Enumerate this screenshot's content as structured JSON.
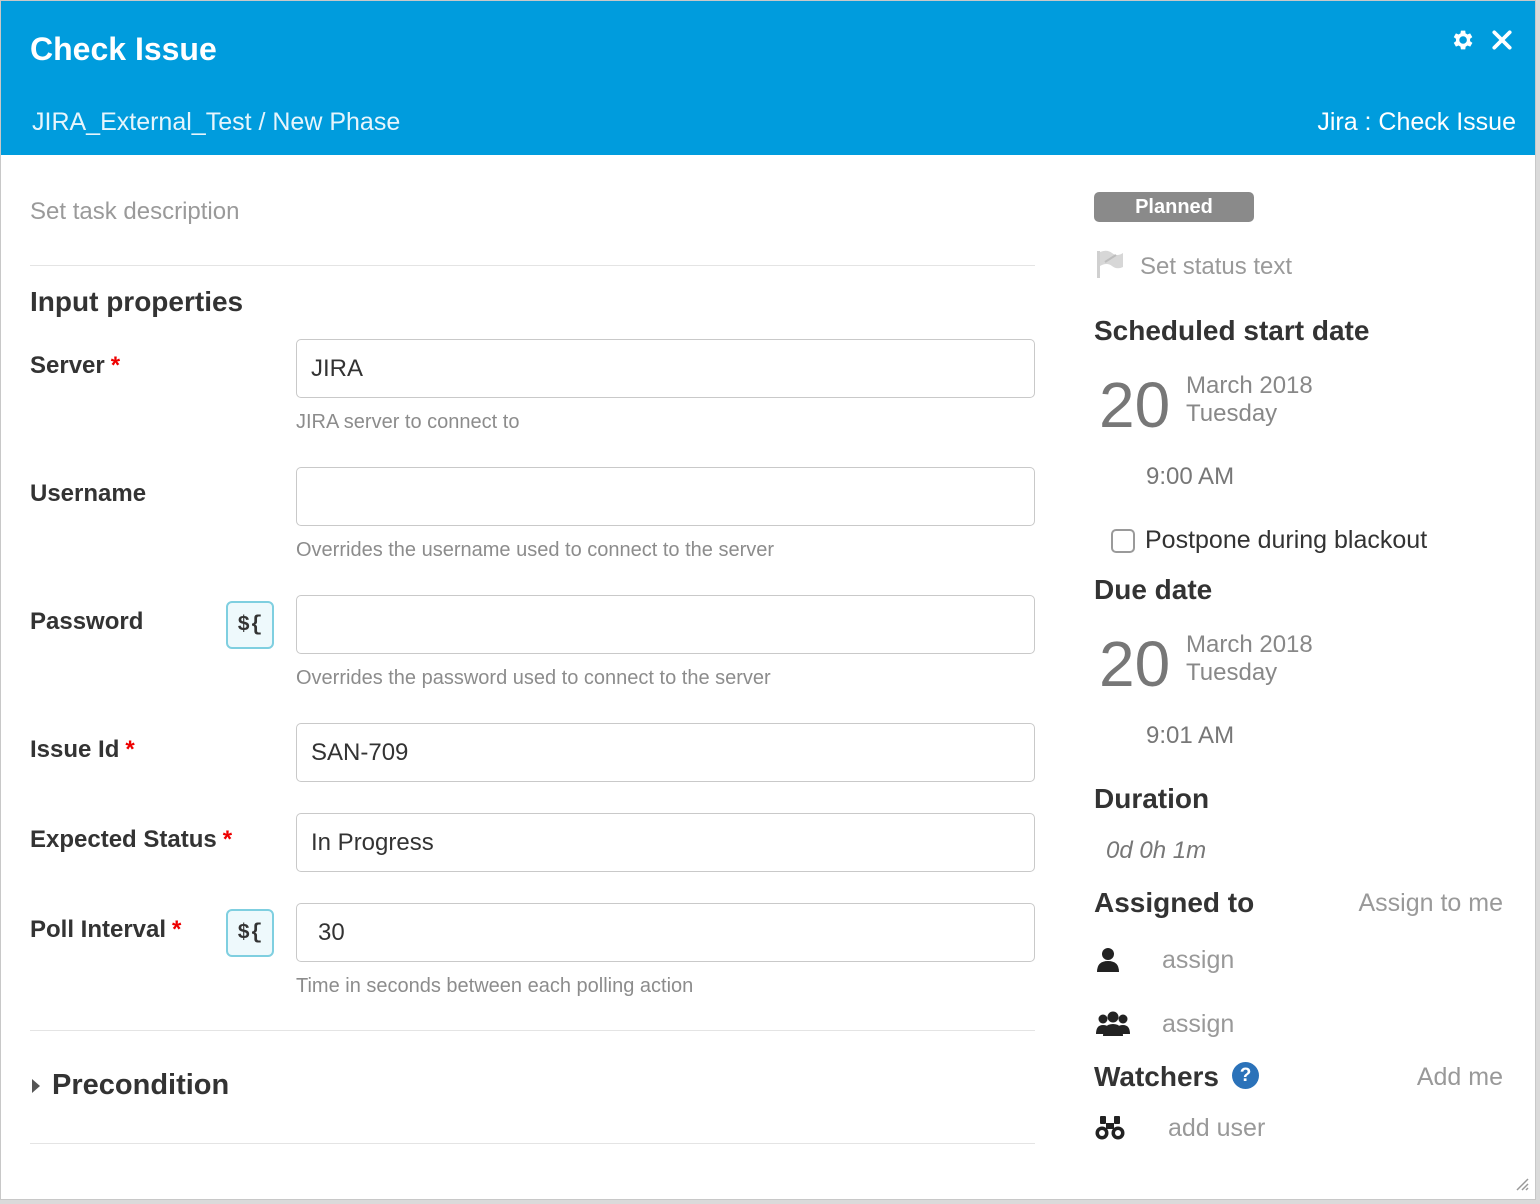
{
  "header": {
    "title": "Check Issue",
    "breadcrumb": "JIRA_External_Test / New Phase",
    "task_type": "Jira : Check Issue",
    "background_color": "#009cdd",
    "icons": [
      "gear-icon",
      "close-icon"
    ]
  },
  "description": {
    "placeholder": "Set task description"
  },
  "input_section": {
    "title": "Input properties",
    "required_marker": "*",
    "variable_button": "${",
    "fields": {
      "server": {
        "label": "Server",
        "value": "JIRA",
        "help": "JIRA server to connect to"
      },
      "username": {
        "label": "Username",
        "value": "",
        "help": "Overrides the username used to connect to the server"
      },
      "password": {
        "label": "Password",
        "value": "",
        "help": "Overrides the password used to connect to the server"
      },
      "issue_id": {
        "label": "Issue Id",
        "value": "SAN-709"
      },
      "expected_status": {
        "label": "Expected Status",
        "value": "In Progress"
      },
      "poll_interval": {
        "label": "Poll Interval",
        "value": "30",
        "help": "Time in seconds between each polling action"
      }
    }
  },
  "precondition": {
    "label": "Precondition"
  },
  "sidebar": {
    "status_badge": "Planned",
    "status_badge_color": "#8a8a8a",
    "status_text_placeholder": "Set status text",
    "scheduled_start": {
      "title": "Scheduled start date",
      "day": "20",
      "month_year": "March 2018",
      "weekday": "Tuesday",
      "time": "9:00 AM"
    },
    "postpone_label": "Postpone during blackout",
    "due": {
      "title": "Due date",
      "day": "20",
      "month_year": "March 2018",
      "weekday": "Tuesday",
      "time": "9:01 AM"
    },
    "duration": {
      "title": "Duration",
      "value": "0d 0h 1m"
    },
    "assigned": {
      "title": "Assigned to",
      "assign_me": "Assign to me",
      "user_link": "assign",
      "team_link": "assign"
    },
    "watchers": {
      "title": "Watchers",
      "help": "?",
      "add_me": "Add me",
      "add_user": "add user"
    }
  }
}
